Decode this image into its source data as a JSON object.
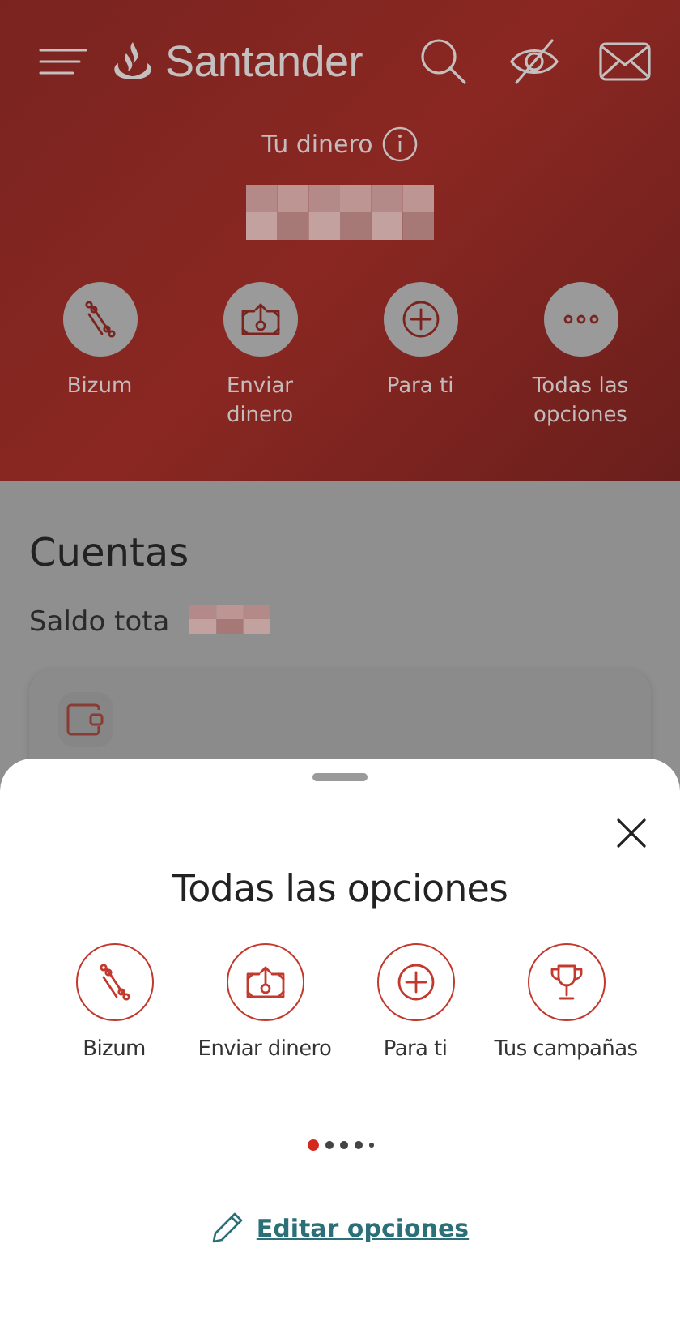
{
  "header": {
    "brand": "Santander",
    "balance_label": "Tu dinero"
  },
  "quick_actions": [
    {
      "kind": "bizum",
      "label": "Bizum"
    },
    {
      "kind": "send",
      "label": "Enviar dinero"
    },
    {
      "kind": "plus",
      "label": "Para ti"
    },
    {
      "kind": "more",
      "label": "Todas las opciones"
    }
  ],
  "accounts": {
    "title": "Cuentas",
    "total_label": "Saldo tota"
  },
  "sheet": {
    "title": "Todas las opciones",
    "options": [
      {
        "kind": "bizum",
        "label": "Bizum"
      },
      {
        "kind": "send",
        "label": "Enviar dinero"
      },
      {
        "kind": "plus",
        "label": "Para ti"
      },
      {
        "kind": "trophy",
        "label": "Tus campañas"
      }
    ],
    "page_dots": [
      {
        "selected": true
      },
      {
        "selected": false
      },
      {
        "selected": false
      },
      {
        "selected": false
      },
      {
        "selected": false
      }
    ],
    "edit_link": "Editar opciones"
  }
}
